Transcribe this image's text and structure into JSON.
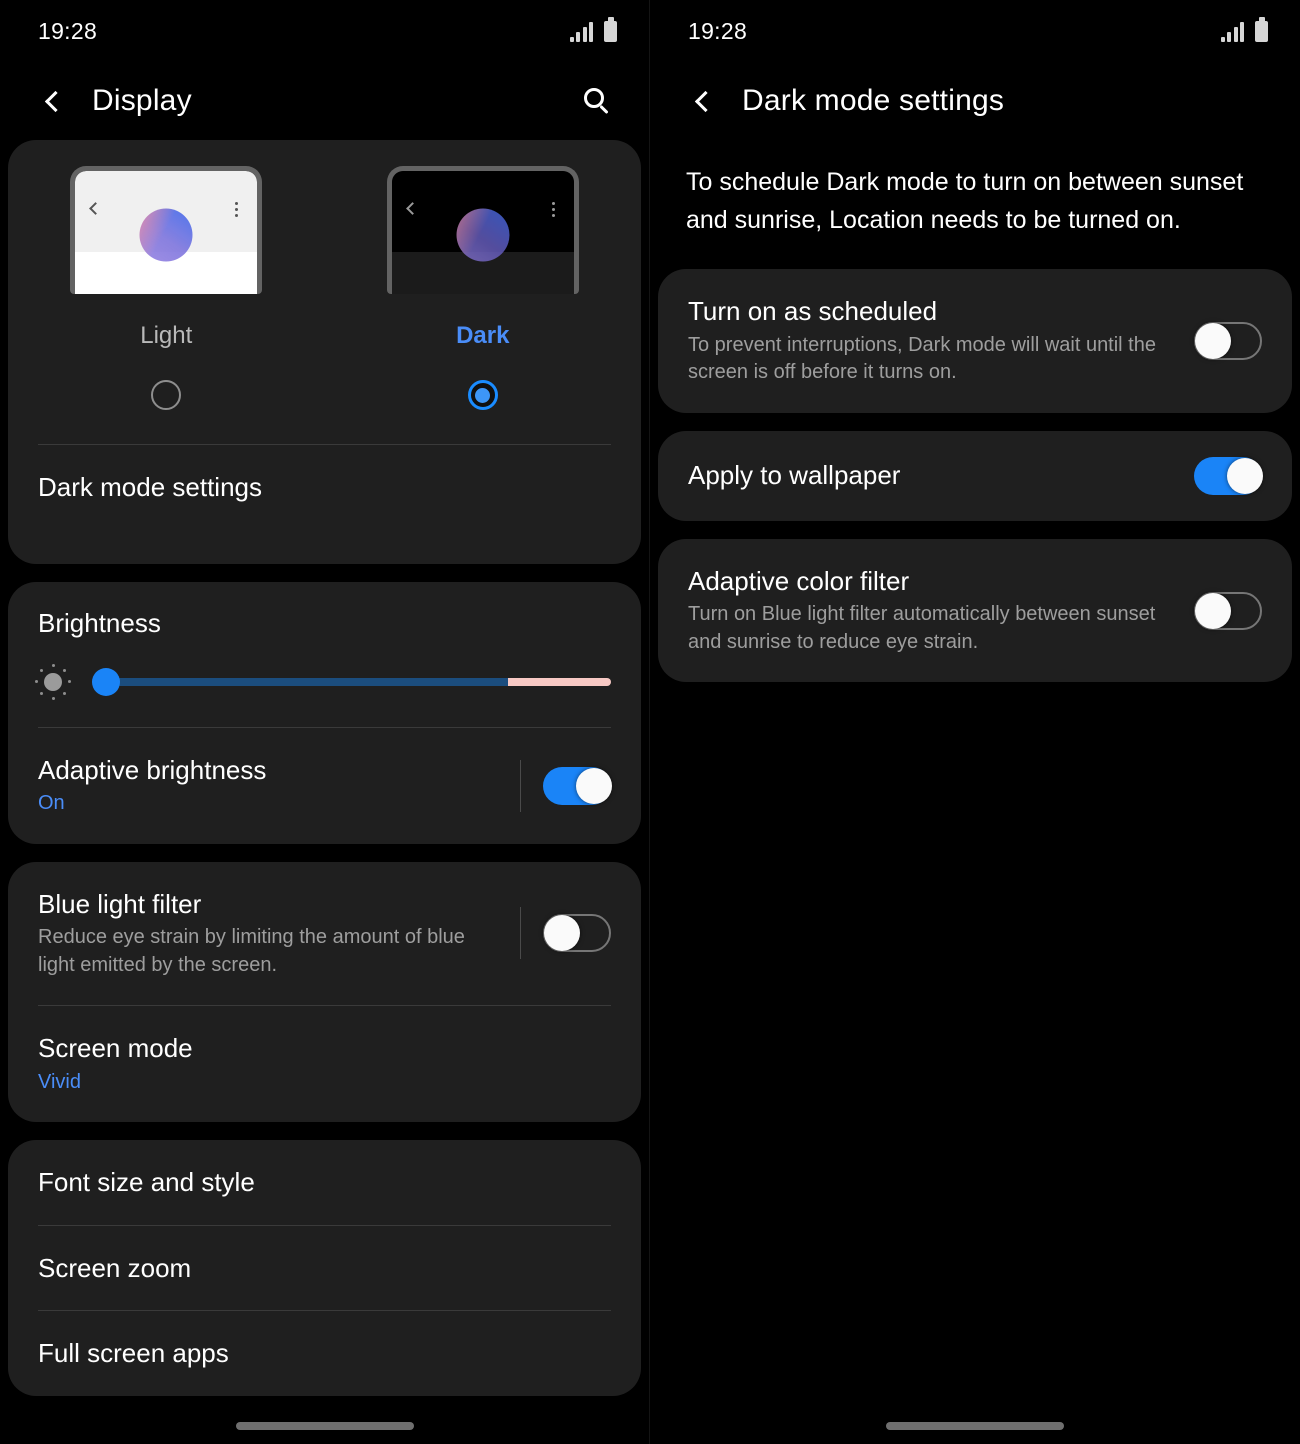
{
  "left": {
    "status": {
      "time": "19:28",
      "signal_icon": "signal-bars-icon",
      "battery_icon": "battery-icon"
    },
    "appbar": {
      "back_icon": "back-chevron-icon",
      "title": "Display",
      "search_icon": "search-icon"
    },
    "theme": {
      "options": [
        {
          "label": "Light",
          "selected": false
        },
        {
          "label": "Dark",
          "selected": true
        }
      ],
      "dark_mode_settings_label": "Dark mode settings"
    },
    "brightness": {
      "title": "Brightness",
      "icon": "brightness-sun-icon",
      "value_percent": 2,
      "adaptive": {
        "title": "Adaptive brightness",
        "status": "On",
        "toggle_state": "on"
      }
    },
    "blue_light": {
      "title": "Blue light filter",
      "description": "Reduce eye strain by limiting the amount of blue light emitted by the screen.",
      "toggle_state": "off"
    },
    "screen_mode": {
      "title": "Screen mode",
      "value": "Vivid"
    },
    "list": [
      {
        "label": "Font size and style"
      },
      {
        "label": "Screen zoom"
      },
      {
        "label": "Full screen apps"
      }
    ]
  },
  "right": {
    "status": {
      "time": "19:28",
      "signal_icon": "signal-bars-icon",
      "battery_icon": "battery-icon"
    },
    "appbar": {
      "back_icon": "back-chevron-icon",
      "title": "Dark mode settings"
    },
    "intro": "To schedule Dark mode to turn on between sunset and sunrise, Location needs to be turned on.",
    "items": [
      {
        "title": "Turn on as scheduled",
        "description": "To prevent interruptions, Dark mode will wait until the screen is off before it turns on.",
        "toggle_state": "off"
      },
      {
        "title": "Apply to wallpaper",
        "description": "",
        "toggle_state": "on"
      },
      {
        "title": "Adaptive color filter",
        "description": "Turn on Blue light filter automatically between sunset and sunrise to reduce eye strain.",
        "toggle_state": "off"
      }
    ]
  },
  "colors": {
    "accent": "#4a8df8",
    "toggle_on": "#1a84f7",
    "card_bg": "#1f1f1f",
    "page_bg": "#000000",
    "slider_track": "#1b4d7e",
    "slider_track_end": "#f7c9c4"
  }
}
